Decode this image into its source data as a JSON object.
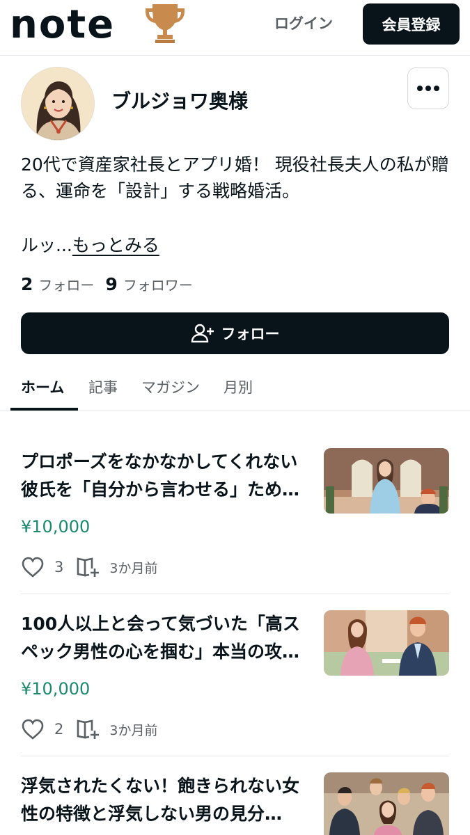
{
  "header": {
    "logo_text": "note",
    "login_label": "ログイン",
    "signup_label": "会員登録"
  },
  "profile": {
    "name": "ブルジョワ奥様",
    "bio": "20代で資産家社長とアプリ婚！ 現役社長夫人の私が贈る、運命を「設計」する戦略婚活。",
    "bio_truncated": "ルッ...",
    "more_link": "もっとみる",
    "following_count": "2",
    "following_label": "フォロー",
    "followers_count": "9",
    "followers_label": "フォロワー",
    "follow_button_label": "フォロー"
  },
  "tabs": [
    {
      "label": "ホーム",
      "active": true
    },
    {
      "label": "記事",
      "active": false
    },
    {
      "label": "マガジン",
      "active": false
    },
    {
      "label": "月別",
      "active": false
    }
  ],
  "articles": [
    {
      "title": "プロポーズをなかなかしてくれない彼氏を「自分から言わせる」ため…",
      "price": "¥10,000",
      "likes": "3",
      "time": "3か月前"
    },
    {
      "title": "100人以上と会って気づいた「高スペック男性の心を掴む」本当の攻…",
      "price": "¥10,000",
      "likes": "2",
      "time": "3か月前"
    },
    {
      "title": "浮気されたくない！飽きられない女性の特徴と浮気しない男の見分…"
    }
  ],
  "colors": {
    "primary_dark": "#08131a",
    "price_green": "#1a8a6f",
    "muted_text": "#595f63",
    "trophy_bronze": "#c98a4e"
  },
  "icons": {
    "more": "more-horizontal-icon",
    "follow": "user-plus-icon",
    "like": "heart-icon",
    "magazine": "magazine-add-icon"
  }
}
